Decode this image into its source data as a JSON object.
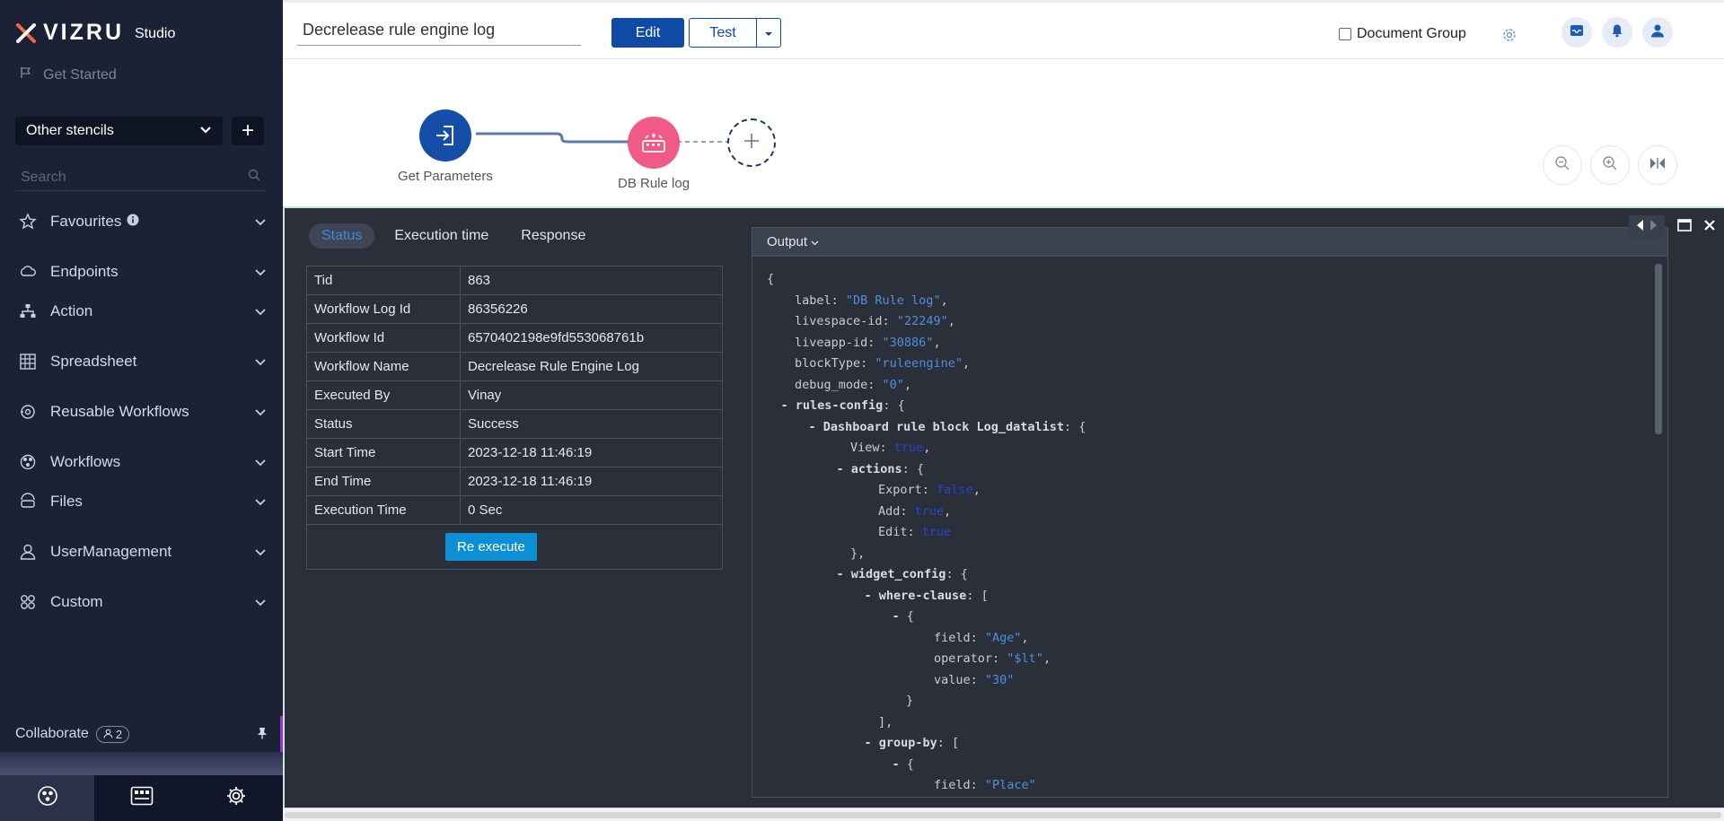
{
  "brand": {
    "name": "VIZRU",
    "sub": "Studio"
  },
  "sidebar": {
    "get_started": "Get Started",
    "stencil_select": "Other stencils",
    "add_label": "+",
    "search_placeholder": "Search",
    "items": [
      {
        "label": "Favourites",
        "icon": "star-icon"
      },
      {
        "label": "Endpoints",
        "icon": "cloud-icon"
      },
      {
        "label": "Action",
        "icon": "hierarchy-icon"
      },
      {
        "label": "Spreadsheet",
        "icon": "grid-icon"
      },
      {
        "label": "Reusable Workflows",
        "icon": "reuse-icon"
      },
      {
        "label": "Workflows",
        "icon": "workflow-icon"
      },
      {
        "label": "Files",
        "icon": "files-icon"
      },
      {
        "label": "UserManagement",
        "icon": "user-icon"
      },
      {
        "label": "Custom",
        "icon": "custom-icon"
      }
    ],
    "collaborate": {
      "label": "Collaborate",
      "count": "2"
    }
  },
  "topbar": {
    "workflow_title": "Decrelease rule engine log",
    "edit_label": "Edit",
    "test_label": "Test",
    "document_group": "Document Group"
  },
  "canvas": {
    "nodes": [
      {
        "label": "Get Parameters"
      },
      {
        "label": "DB Rule log"
      }
    ]
  },
  "log": {
    "tabs": [
      "Status",
      "Execution time",
      "Response"
    ],
    "rows": [
      {
        "key": "Tid",
        "value": "863"
      },
      {
        "key": "Workflow Log Id",
        "value": "86356226"
      },
      {
        "key": "Workflow Id",
        "value": "6570402198e9fd553068761b"
      },
      {
        "key": "Workflow Name",
        "value": "Decrelease Rule Engine Log"
      },
      {
        "key": "Executed By",
        "value": "Vinay"
      },
      {
        "key": "Status",
        "value": "Success"
      },
      {
        "key": "Start Time",
        "value": "2023-12-18 11:46:19"
      },
      {
        "key": "End Time",
        "value": "2023-12-18 11:46:19"
      },
      {
        "key": "Execution Time",
        "value": "0 Sec"
      }
    ],
    "reexecute_label": "Re execute",
    "output_label": "Output"
  },
  "output_lines": [
    {
      "indent": 0,
      "parts": [
        [
          "p",
          "{"
        ]
      ]
    },
    {
      "indent": 1,
      "parts": [
        [
          "k",
          "label"
        ],
        [
          "p",
          ": "
        ],
        [
          "s",
          "\"DB Rule log\""
        ],
        [
          "p",
          ","
        ]
      ]
    },
    {
      "indent": 1,
      "parts": [
        [
          "k",
          "livespace-id"
        ],
        [
          "p",
          ": "
        ],
        [
          "s",
          "\"22249\""
        ],
        [
          "p",
          ","
        ]
      ]
    },
    {
      "indent": 1,
      "parts": [
        [
          "k",
          "liveapp-id"
        ],
        [
          "p",
          ": "
        ],
        [
          "s",
          "\"30886\""
        ],
        [
          "p",
          ","
        ]
      ]
    },
    {
      "indent": 1,
      "parts": [
        [
          "k",
          "blockType"
        ],
        [
          "p",
          ": "
        ],
        [
          "s",
          "\"ruleengine\""
        ],
        [
          "p",
          ","
        ]
      ]
    },
    {
      "indent": 1,
      "parts": [
        [
          "k",
          "debug_mode"
        ],
        [
          "p",
          ": "
        ],
        [
          "s",
          "\"0\""
        ],
        [
          "p",
          ","
        ]
      ]
    },
    {
      "indent": 0.5,
      "parts": [
        [
          "d",
          "- "
        ],
        [
          "b",
          "rules-config"
        ],
        [
          "p",
          ": {"
        ]
      ]
    },
    {
      "indent": 1.5,
      "parts": [
        [
          "d",
          "- "
        ],
        [
          "b",
          "Dashboard rule block Log_datalist"
        ],
        [
          "p",
          ": {"
        ]
      ]
    },
    {
      "indent": 3,
      "parts": [
        [
          "k",
          "View"
        ],
        [
          "p",
          ": "
        ],
        [
          "n",
          "true"
        ],
        [
          "p",
          ","
        ]
      ]
    },
    {
      "indent": 2.5,
      "parts": [
        [
          "d",
          "- "
        ],
        [
          "b",
          "actions"
        ],
        [
          "p",
          ": {"
        ]
      ]
    },
    {
      "indent": 4,
      "parts": [
        [
          "k",
          "Export"
        ],
        [
          "p",
          ": "
        ],
        [
          "n",
          "false"
        ],
        [
          "p",
          ","
        ]
      ]
    },
    {
      "indent": 4,
      "parts": [
        [
          "k",
          "Add"
        ],
        [
          "p",
          ": "
        ],
        [
          "n",
          "true"
        ],
        [
          "p",
          ","
        ]
      ]
    },
    {
      "indent": 4,
      "parts": [
        [
          "k",
          "Edit"
        ],
        [
          "p",
          ": "
        ],
        [
          "n",
          "true"
        ]
      ]
    },
    {
      "indent": 3,
      "parts": [
        [
          "p",
          "},"
        ]
      ]
    },
    {
      "indent": 2.5,
      "parts": [
        [
          "d",
          "- "
        ],
        [
          "b",
          "widget_config"
        ],
        [
          "p",
          ": {"
        ]
      ]
    },
    {
      "indent": 3.5,
      "parts": [
        [
          "d",
          "- "
        ],
        [
          "b",
          "where-clause"
        ],
        [
          "p",
          ": ["
        ]
      ]
    },
    {
      "indent": 4.5,
      "parts": [
        [
          "d",
          "- "
        ],
        [
          "p",
          "{"
        ]
      ]
    },
    {
      "indent": 6,
      "parts": [
        [
          "k",
          "field"
        ],
        [
          "p",
          ": "
        ],
        [
          "s",
          "\"Age\""
        ],
        [
          "p",
          ","
        ]
      ]
    },
    {
      "indent": 6,
      "parts": [
        [
          "k",
          "operator"
        ],
        [
          "p",
          ": "
        ],
        [
          "s",
          "\"$lt\""
        ],
        [
          "p",
          ","
        ]
      ]
    },
    {
      "indent": 6,
      "parts": [
        [
          "k",
          "value"
        ],
        [
          "p",
          ": "
        ],
        [
          "s",
          "\"30\""
        ]
      ]
    },
    {
      "indent": 5,
      "parts": [
        [
          "p",
          "}"
        ]
      ]
    },
    {
      "indent": 4,
      "parts": [
        [
          "p",
          "],"
        ]
      ]
    },
    {
      "indent": 3.5,
      "parts": [
        [
          "d",
          "- "
        ],
        [
          "b",
          "group-by"
        ],
        [
          "p",
          ": ["
        ]
      ]
    },
    {
      "indent": 4.5,
      "parts": [
        [
          "d",
          "- "
        ],
        [
          "p",
          "{"
        ]
      ]
    },
    {
      "indent": 6,
      "parts": [
        [
          "k",
          "field"
        ],
        [
          "p",
          ": "
        ],
        [
          "s",
          "\"Place\""
        ]
      ]
    }
  ]
}
